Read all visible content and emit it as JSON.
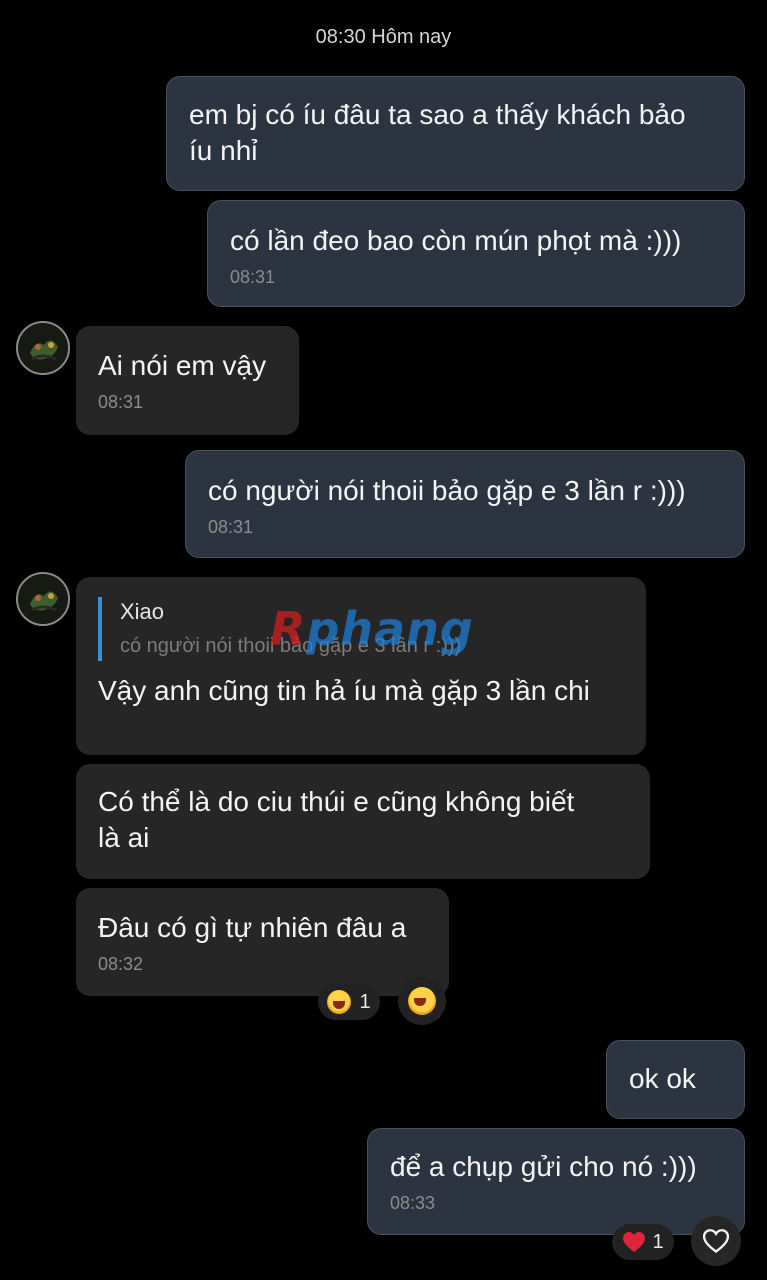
{
  "header": {
    "date_separator": "08:30 Hôm nay"
  },
  "messages": [
    {
      "direction": "out",
      "text": "em bj có íu đâu ta sao a thấy khách bảo\níu nhỉ",
      "time": ""
    },
    {
      "direction": "out",
      "text": "có lần đeo bao còn mún phọt mà :)))",
      "time": "08:31"
    },
    {
      "direction": "in",
      "text": "Ai nói em vậy",
      "time": "08:31"
    },
    {
      "direction": "out",
      "text": "có người nói thoii bảo gặp e 3 lần r :)))",
      "time": "08:31"
    },
    {
      "direction": "in",
      "reply_to": {
        "name": "Xiao",
        "text": "có người nói thoii bảo gặp e 3 lần r :)))"
      },
      "text": "Vậy anh cũng tin hả íu mà gặp 3 lần chi",
      "time": ""
    },
    {
      "direction": "in",
      "text": "Có thể là do ciu thúi e cũng không biết\nlà ai",
      "time": ""
    },
    {
      "direction": "in",
      "text": "Đâu có gì tự nhiên đâu a",
      "time": "08:32"
    },
    {
      "direction": "out",
      "text": "ok ok",
      "time": ""
    },
    {
      "direction": "out",
      "text": "để a chụp gửi cho nó :)))",
      "time": "08:33"
    }
  ],
  "reactions": {
    "laugh_count": "1",
    "heart_count": "1"
  },
  "watermark": {
    "part1": "R",
    "part2": "phang"
  },
  "icons": {
    "laugh_reaction": "laughing-face-icon",
    "add_reaction": "laughing-face-icon",
    "heart_reaction": "red-heart-icon",
    "like_button": "heart-outline-icon"
  },
  "colors": {
    "background": "#000000",
    "outgoing_bubble": "#2b3440",
    "incoming_bubble": "#262626",
    "reply_bar": "#3a8fd6",
    "timestamp": "#8c8c8c"
  }
}
